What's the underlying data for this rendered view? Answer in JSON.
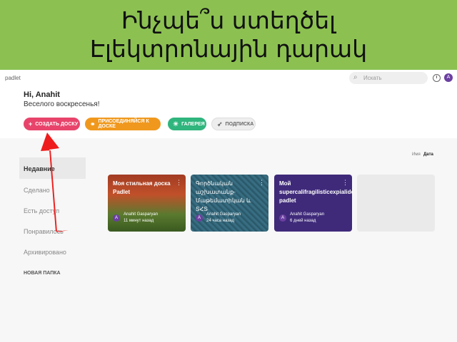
{
  "banner": {
    "line1": "Ինչպե՞ս ստեղծել",
    "line2": "Էլեկտրոնային դարակ"
  },
  "app": {
    "logo": "padlet",
    "search_placeholder": "Искать",
    "avatar_letter": "A"
  },
  "greeting": {
    "title": "Hi, Anahit",
    "subtitle": "Веселого воскресенья!"
  },
  "buttons": {
    "create": "СОЗДАТЬ ДОСКУ",
    "join": "ПРИСОЕДИНЯЙСЯ К ДОСКЕ",
    "gallery": "ГАЛЕРЕЯ",
    "subscribe": "ПОДПИСКА"
  },
  "sort": {
    "by_name": "Имя",
    "by_date": "Дата"
  },
  "sidebar": {
    "items": [
      {
        "label": "Недавние"
      },
      {
        "label": "Сделано"
      },
      {
        "label": "Есть доступ"
      },
      {
        "label": "Понравилось"
      },
      {
        "label": "Архивировано"
      }
    ],
    "new_folder": "НОВАЯ ПАПКА"
  },
  "cards": [
    {
      "title": "Моя стильная доска Padlet",
      "owner": "Anahit Gasparyan",
      "date": "11 минут назад",
      "avatar": "A"
    },
    {
      "title": "Գործնական աշխատանք-Մաթեմատիկան և ՏՀՏ",
      "owner": "Anahit Gasparyan",
      "date": "24 часа назад",
      "avatar": "A"
    },
    {
      "title": "Мой supercalifragilisticexpialidocious padlet",
      "owner": "Anahit Gasparyan",
      "date": "6 дней назад",
      "avatar": "A"
    }
  ],
  "colors": {
    "banner": "#8cc152",
    "create": "#e8446b",
    "join": "#f0981d",
    "gallery": "#2fb57d",
    "arrow": "#ee1c1c"
  }
}
